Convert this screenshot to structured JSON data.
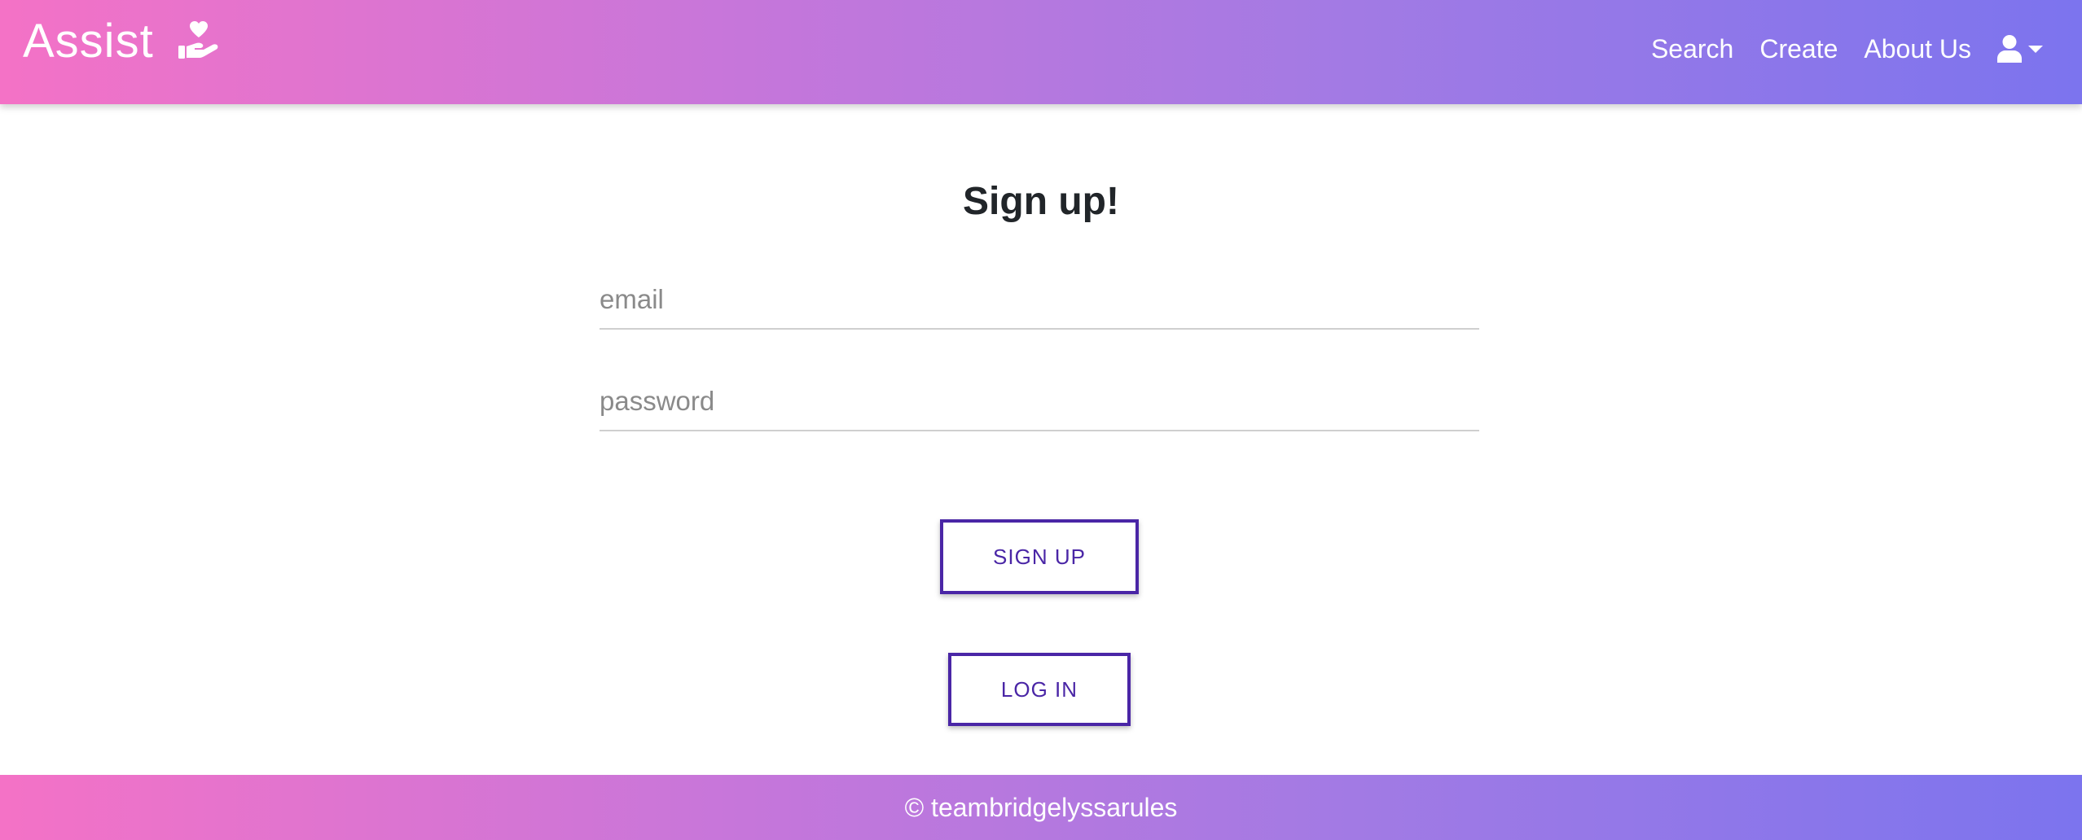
{
  "navbar": {
    "brand": "Assist",
    "brand_icon": "hand-holding-heart-icon",
    "links": [
      "Search",
      "Create",
      "About Us"
    ],
    "user_icon": "user-icon",
    "caret_icon": "caret-down-icon",
    "gradient": [
      "#f472c6",
      "#c776da",
      "#a27ae4",
      "#7c74ee"
    ]
  },
  "form": {
    "title": "Sign up!",
    "email_placeholder": "email",
    "password_placeholder": "password",
    "signup_label": "SIGN UP",
    "login_label": "LOG IN",
    "button_color": "#4a26a6"
  },
  "footer": {
    "text": "© teambridgelyssarules"
  }
}
